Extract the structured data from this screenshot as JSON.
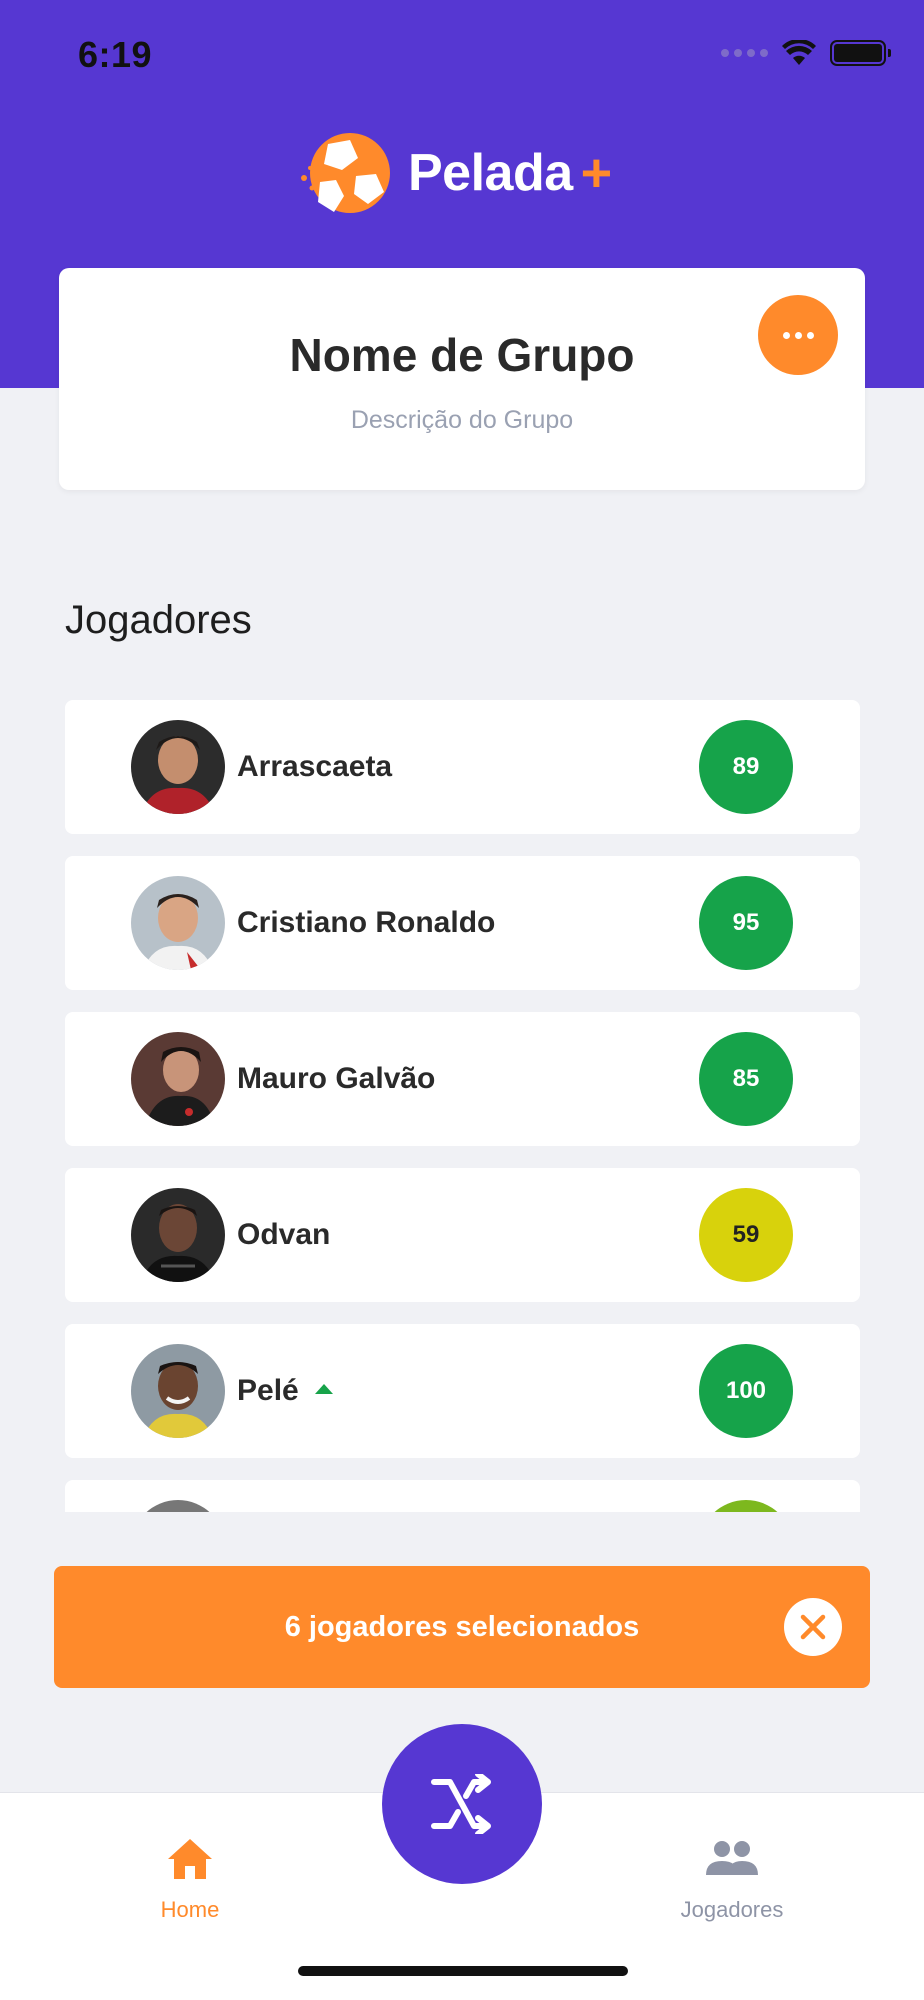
{
  "status_bar": {
    "time": "6:19"
  },
  "brand": {
    "name": "Pelada",
    "plus": "+"
  },
  "group": {
    "title": "Nome de Grupo",
    "description": "Descrição do Grupo"
  },
  "players_section": {
    "title": "Jogadores",
    "players": [
      {
        "name": "Arrascaeta",
        "rating": "89",
        "rating_color": "#16A34A",
        "trend": ""
      },
      {
        "name": "Cristiano Ronaldo",
        "rating": "95",
        "rating_color": "#16A34A",
        "trend": ""
      },
      {
        "name": "Mauro Galvão",
        "rating": "85",
        "rating_color": "#16A34A",
        "trend": ""
      },
      {
        "name": "Odvan",
        "rating": "59",
        "rating_color": "#D8D20C",
        "trend": ""
      },
      {
        "name": "Pelé",
        "rating": "100",
        "rating_color": "#16A34A",
        "trend": "up"
      }
    ]
  },
  "selection": {
    "text": "6 jogadores selecionados"
  },
  "tabs": {
    "home": {
      "label": "Home",
      "icon": "home-icon"
    },
    "players": {
      "label": "Jogadores",
      "icon": "people-icon"
    }
  },
  "colors": {
    "primary": "#5637D2",
    "accent": "#FF8A2B",
    "good": "#16A34A",
    "mid": "#D8D20C"
  }
}
